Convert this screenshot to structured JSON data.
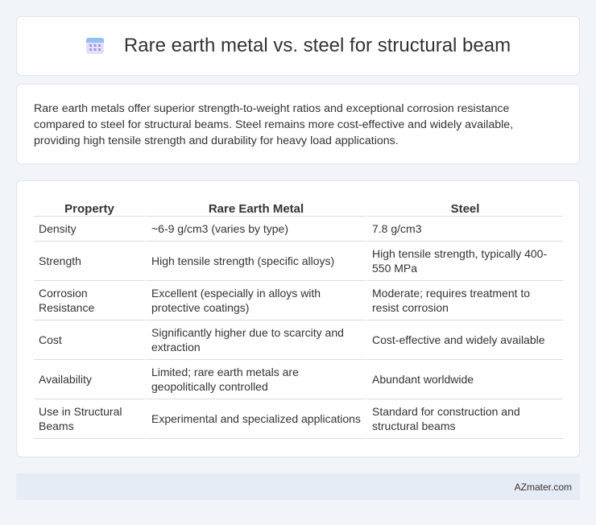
{
  "header": {
    "title": "Rare earth metal vs. steel for structural beam",
    "icon": "calendar-icon",
    "icon_color": "#8a7ce6"
  },
  "summary": {
    "text": "Rare earth metals offer superior strength-to-weight ratios and exceptional corrosion resistance compared to steel for structural beams. Steel remains more cost-effective and widely available, providing high tensile strength and durability for heavy load applications."
  },
  "table": {
    "headers": [
      "Property",
      "Rare Earth Metal",
      "Steel"
    ],
    "rows": [
      [
        "Density",
        "~6-9 g/cm3 (varies by type)",
        "7.8 g/cm3"
      ],
      [
        "Strength",
        "High tensile strength (specific alloys)",
        "High tensile strength, typically 400-550 MPa"
      ],
      [
        "Corrosion Resistance",
        "Excellent (especially in alloys with protective coatings)",
        "Moderate; requires treatment to resist corrosion"
      ],
      [
        "Cost",
        "Significantly higher due to scarcity and extraction",
        "Cost-effective and widely available"
      ],
      [
        "Availability",
        "Limited; rare earth metals are geopolitically controlled",
        "Abundant worldwide"
      ],
      [
        "Use in Structural Beams",
        "Experimental and specialized applications",
        "Standard for construction and structural beams"
      ]
    ]
  },
  "footer": {
    "brand": "AZmater.com"
  }
}
